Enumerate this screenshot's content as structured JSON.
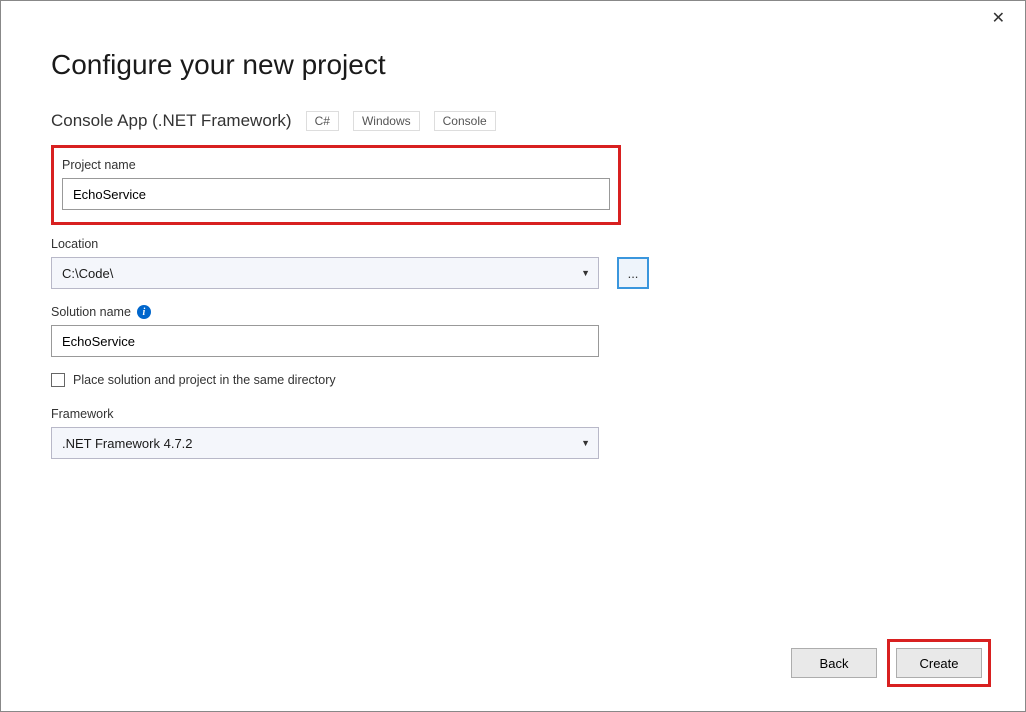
{
  "window": {
    "close_glyph": "✕"
  },
  "header": {
    "title": "Configure your new project",
    "subtitle": "Console App (.NET Framework)",
    "tags": [
      "C#",
      "Windows",
      "Console"
    ]
  },
  "project_name": {
    "label": "Project name",
    "value": "EchoService"
  },
  "location": {
    "label": "Location",
    "value": "C:\\Code\\",
    "browse_label": "..."
  },
  "solution_name": {
    "label": "Solution name",
    "value": "EchoService",
    "info_glyph": "i"
  },
  "same_dir": {
    "label": "Place solution and project in the same directory",
    "checked": false
  },
  "framework": {
    "label": "Framework",
    "value": ".NET Framework 4.7.2"
  },
  "footer": {
    "back": "Back",
    "create": "Create"
  }
}
